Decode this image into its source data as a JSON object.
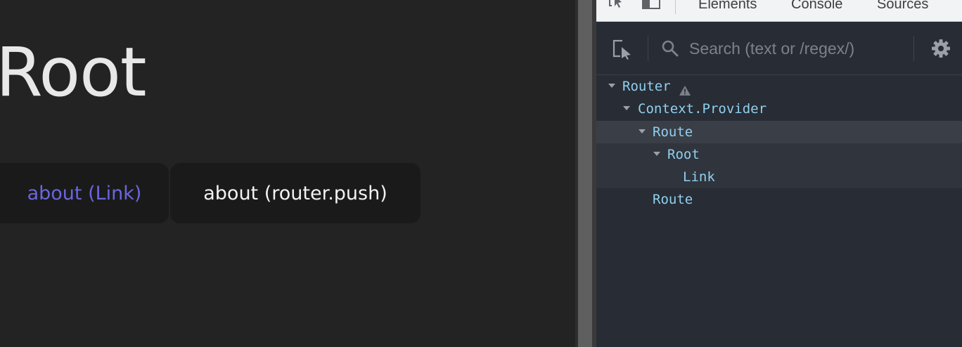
{
  "app": {
    "title": "Root",
    "buttons": {
      "link": "about (Link)",
      "push": "about (router.push)"
    }
  },
  "devtools": {
    "tabs": [
      "Elements",
      "Console",
      "Sources"
    ],
    "search": {
      "placeholder": "Search (text or /regex/)",
      "value": ""
    },
    "tree": [
      {
        "label": "Router",
        "expanded": true,
        "depth": 0,
        "warning": true
      },
      {
        "label": "Context.Provider",
        "expanded": true,
        "depth": 1
      },
      {
        "label": "Route",
        "expanded": true,
        "depth": 2,
        "selected": true
      },
      {
        "label": "Root",
        "expanded": true,
        "depth": 3
      },
      {
        "label": "Link",
        "expanded": false,
        "depth": 4
      },
      {
        "label": "Route",
        "expanded": false,
        "depth": 2
      }
    ],
    "icons": {
      "tab_inspect": "cursor-select-icon",
      "tab_device": "device-toggle-icon",
      "select": "select-element-icon",
      "search": "search-icon",
      "settings": "gear-icon",
      "warning": "warning-icon"
    },
    "colors": {
      "component": "#8fd0f0",
      "background": "#282c34",
      "selected_row": "#3a3e47"
    }
  },
  "colors": {
    "app_background": "#232323",
    "link_text": "#6a66e0",
    "button_background": "#1a1a1a"
  }
}
